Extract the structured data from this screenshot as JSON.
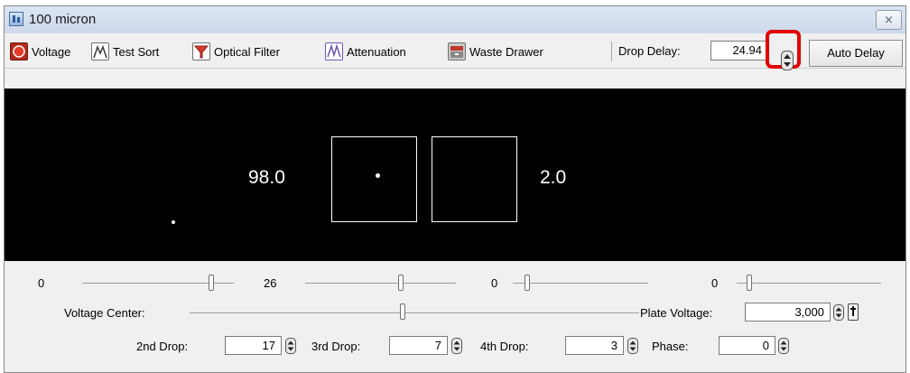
{
  "window": {
    "title": "100 micron"
  },
  "toolbar": {
    "voltage_label": "Voltage",
    "test_sort_label": "Test Sort",
    "optical_filter_label": "Optical Filter",
    "attenuation_label": "Attenuation",
    "waste_drawer_label": "Waste Drawer",
    "drop_delay_label": "Drop Delay:",
    "drop_delay_value": "24.94",
    "auto_delay_label": "Auto Delay"
  },
  "display": {
    "left_percent": "98.0",
    "right_percent": "2.0"
  },
  "sliders": [
    {
      "value_label": "0"
    },
    {
      "value_label": "26"
    },
    {
      "value_label": "0"
    },
    {
      "value_label": "0"
    }
  ],
  "voltage_center": {
    "label": "Voltage Center:"
  },
  "plate_voltage": {
    "label": "Plate Voltage:",
    "value": "3,000"
  },
  "drops": {
    "second": {
      "label": "2nd Drop:",
      "value": "17"
    },
    "third": {
      "label": "3rd Drop:",
      "value": "7"
    },
    "fourth": {
      "label": "4th Drop:",
      "value": "3"
    },
    "phase": {
      "label": "Phase:",
      "value": "0"
    }
  },
  "colors": {
    "highlight": "#e30000",
    "display_bg": "#000000",
    "window_bg": "#f0f0f0"
  },
  "icons": [
    "app-icon",
    "close-icon",
    "voltage-icon",
    "test-sort-icon",
    "optical-filter-icon",
    "attenuation-icon",
    "waste-drawer-icon",
    "spinner-icon",
    "pin-icon"
  ]
}
